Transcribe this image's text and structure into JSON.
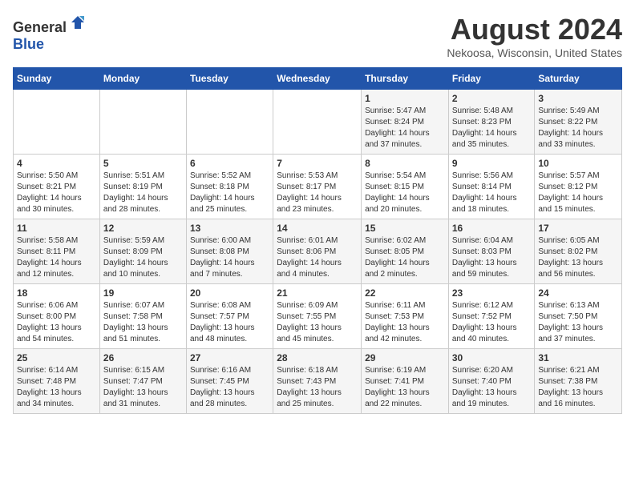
{
  "header": {
    "logo_line1": "General",
    "logo_line2": "Blue",
    "month_year": "August 2024",
    "location": "Nekoosa, Wisconsin, United States"
  },
  "days_of_week": [
    "Sunday",
    "Monday",
    "Tuesday",
    "Wednesday",
    "Thursday",
    "Friday",
    "Saturday"
  ],
  "weeks": [
    [
      {
        "day": "",
        "content": ""
      },
      {
        "day": "",
        "content": ""
      },
      {
        "day": "",
        "content": ""
      },
      {
        "day": "",
        "content": ""
      },
      {
        "day": "1",
        "content": "Sunrise: 5:47 AM\nSunset: 8:24 PM\nDaylight: 14 hours\nand 37 minutes."
      },
      {
        "day": "2",
        "content": "Sunrise: 5:48 AM\nSunset: 8:23 PM\nDaylight: 14 hours\nand 35 minutes."
      },
      {
        "day": "3",
        "content": "Sunrise: 5:49 AM\nSunset: 8:22 PM\nDaylight: 14 hours\nand 33 minutes."
      }
    ],
    [
      {
        "day": "4",
        "content": "Sunrise: 5:50 AM\nSunset: 8:21 PM\nDaylight: 14 hours\nand 30 minutes."
      },
      {
        "day": "5",
        "content": "Sunrise: 5:51 AM\nSunset: 8:19 PM\nDaylight: 14 hours\nand 28 minutes."
      },
      {
        "day": "6",
        "content": "Sunrise: 5:52 AM\nSunset: 8:18 PM\nDaylight: 14 hours\nand 25 minutes."
      },
      {
        "day": "7",
        "content": "Sunrise: 5:53 AM\nSunset: 8:17 PM\nDaylight: 14 hours\nand 23 minutes."
      },
      {
        "day": "8",
        "content": "Sunrise: 5:54 AM\nSunset: 8:15 PM\nDaylight: 14 hours\nand 20 minutes."
      },
      {
        "day": "9",
        "content": "Sunrise: 5:56 AM\nSunset: 8:14 PM\nDaylight: 14 hours\nand 18 minutes."
      },
      {
        "day": "10",
        "content": "Sunrise: 5:57 AM\nSunset: 8:12 PM\nDaylight: 14 hours\nand 15 minutes."
      }
    ],
    [
      {
        "day": "11",
        "content": "Sunrise: 5:58 AM\nSunset: 8:11 PM\nDaylight: 14 hours\nand 12 minutes."
      },
      {
        "day": "12",
        "content": "Sunrise: 5:59 AM\nSunset: 8:09 PM\nDaylight: 14 hours\nand 10 minutes."
      },
      {
        "day": "13",
        "content": "Sunrise: 6:00 AM\nSunset: 8:08 PM\nDaylight: 14 hours\nand 7 minutes."
      },
      {
        "day": "14",
        "content": "Sunrise: 6:01 AM\nSunset: 8:06 PM\nDaylight: 14 hours\nand 4 minutes."
      },
      {
        "day": "15",
        "content": "Sunrise: 6:02 AM\nSunset: 8:05 PM\nDaylight: 14 hours\nand 2 minutes."
      },
      {
        "day": "16",
        "content": "Sunrise: 6:04 AM\nSunset: 8:03 PM\nDaylight: 13 hours\nand 59 minutes."
      },
      {
        "day": "17",
        "content": "Sunrise: 6:05 AM\nSunset: 8:02 PM\nDaylight: 13 hours\nand 56 minutes."
      }
    ],
    [
      {
        "day": "18",
        "content": "Sunrise: 6:06 AM\nSunset: 8:00 PM\nDaylight: 13 hours\nand 54 minutes."
      },
      {
        "day": "19",
        "content": "Sunrise: 6:07 AM\nSunset: 7:58 PM\nDaylight: 13 hours\nand 51 minutes."
      },
      {
        "day": "20",
        "content": "Sunrise: 6:08 AM\nSunset: 7:57 PM\nDaylight: 13 hours\nand 48 minutes."
      },
      {
        "day": "21",
        "content": "Sunrise: 6:09 AM\nSunset: 7:55 PM\nDaylight: 13 hours\nand 45 minutes."
      },
      {
        "day": "22",
        "content": "Sunrise: 6:11 AM\nSunset: 7:53 PM\nDaylight: 13 hours\nand 42 minutes."
      },
      {
        "day": "23",
        "content": "Sunrise: 6:12 AM\nSunset: 7:52 PM\nDaylight: 13 hours\nand 40 minutes."
      },
      {
        "day": "24",
        "content": "Sunrise: 6:13 AM\nSunset: 7:50 PM\nDaylight: 13 hours\nand 37 minutes."
      }
    ],
    [
      {
        "day": "25",
        "content": "Sunrise: 6:14 AM\nSunset: 7:48 PM\nDaylight: 13 hours\nand 34 minutes."
      },
      {
        "day": "26",
        "content": "Sunrise: 6:15 AM\nSunset: 7:47 PM\nDaylight: 13 hours\nand 31 minutes."
      },
      {
        "day": "27",
        "content": "Sunrise: 6:16 AM\nSunset: 7:45 PM\nDaylight: 13 hours\nand 28 minutes."
      },
      {
        "day": "28",
        "content": "Sunrise: 6:18 AM\nSunset: 7:43 PM\nDaylight: 13 hours\nand 25 minutes."
      },
      {
        "day": "29",
        "content": "Sunrise: 6:19 AM\nSunset: 7:41 PM\nDaylight: 13 hours\nand 22 minutes."
      },
      {
        "day": "30",
        "content": "Sunrise: 6:20 AM\nSunset: 7:40 PM\nDaylight: 13 hours\nand 19 minutes."
      },
      {
        "day": "31",
        "content": "Sunrise: 6:21 AM\nSunset: 7:38 PM\nDaylight: 13 hours\nand 16 minutes."
      }
    ]
  ]
}
